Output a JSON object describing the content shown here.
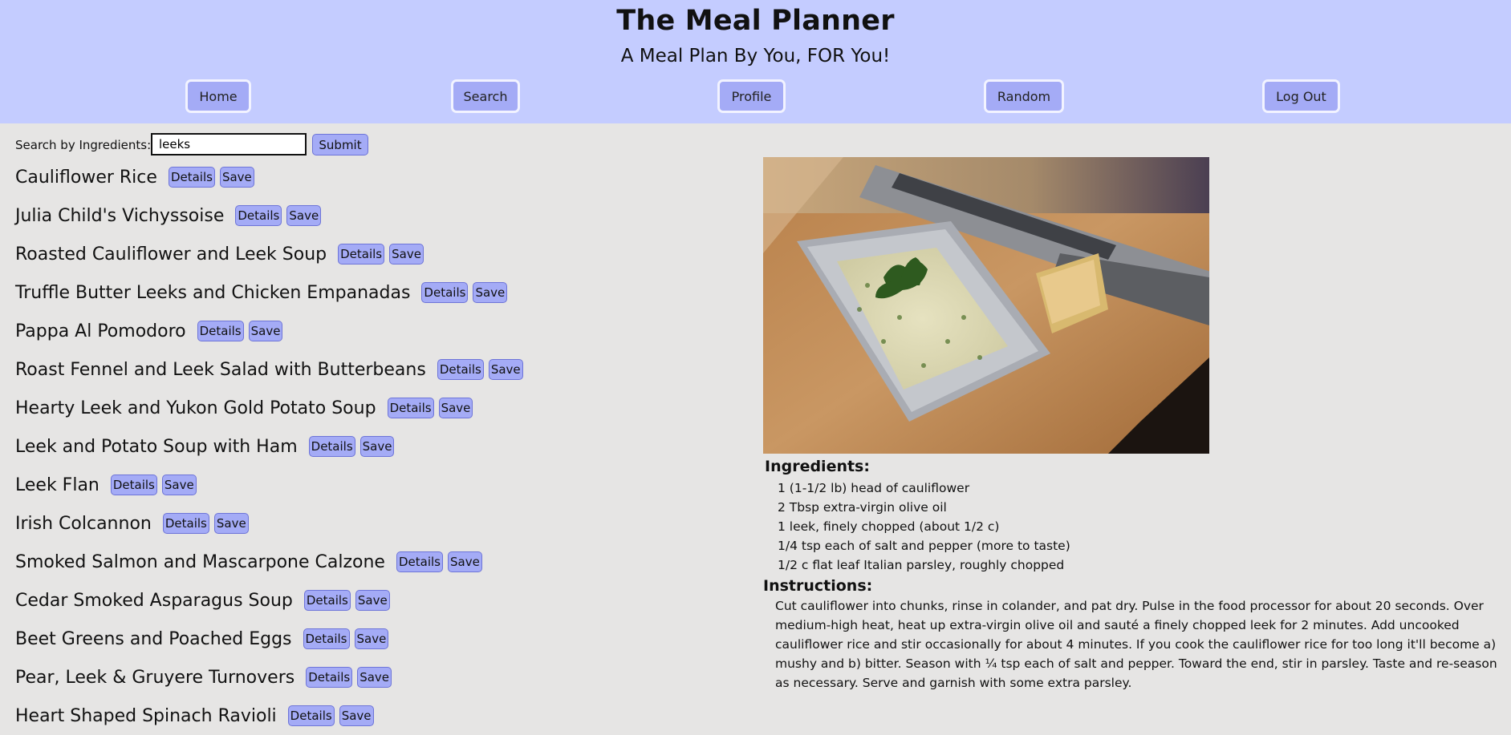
{
  "header": {
    "title": "The Meal Planner",
    "subtitle": "A Meal Plan By You, FOR You!",
    "nav": [
      "Home",
      "Search",
      "Profile",
      "Random",
      "Log Out"
    ]
  },
  "search": {
    "label": "Search by Ingredients:",
    "value": "leeks",
    "submit_label": "Submit"
  },
  "results": {
    "details_label": "Details",
    "save_label": "Save",
    "items": [
      "Cauliflower Rice",
      "Julia Child's Vichyssoise",
      "Roasted Cauliflower and Leek Soup",
      "Truffle Butter Leeks and Chicken Empanadas",
      "Pappa Al Pomodoro",
      "Roast Fennel and Leek Salad with Butterbeans",
      "Hearty Leek and Yukon Gold Potato Soup",
      "Leek and Potato Soup with Ham",
      "Leek Flan",
      "Irish Colcannon",
      "Smoked Salmon and Mascarpone Calzone",
      "Cedar Smoked Asparagus Soup",
      "Beet Greens and Poached Eggs",
      "Pear, Leek & Gruyere Turnovers",
      "Heart Shaped Spinach Ravioli"
    ]
  },
  "recipe": {
    "ingredients_title": "Ingredients:",
    "ingredients": [
      "1 (1-1/2 lb) head of cauliflower",
      "2 Tbsp extra-virgin olive oil",
      "1 leek, finely chopped (about 1/2 c)",
      "1/4 tsp each of salt and pepper (more to taste)",
      "1/2 c flat leaf Italian parsley, roughly chopped"
    ],
    "instructions_title": "Instructions:",
    "instructions": "Cut cauliflower into chunks, rinse in colander, and pat dry. Pulse in the food processor for about 20 seconds. Over medium-high heat, heat up extra-virgin olive oil and sauté a finely chopped leek for 2 minutes. Add uncooked cauliflower rice and stir occasionally for about 4 minutes. If you cook the cauliflower rice for too long it'll become a) mushy and b) bitter. Season with ¼ tsp each of salt and pepper. Toward the end, stir in parsley. Taste and re-season as necessary. Serve and garnish with some extra parsley."
  },
  "colors": {
    "header_bg": "#c4ccff",
    "button_bg": "#a4abf6",
    "page_bg": "#e6e5e4"
  }
}
